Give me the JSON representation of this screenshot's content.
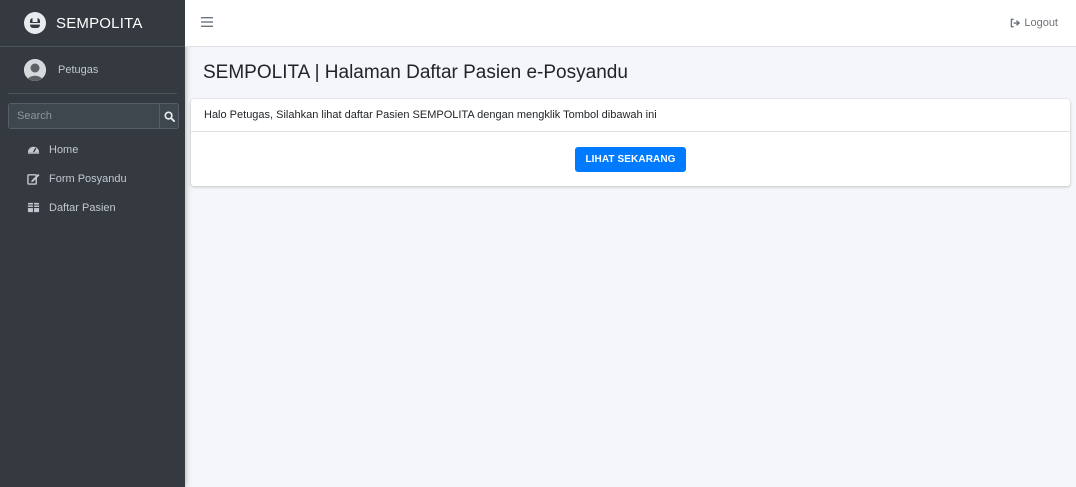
{
  "brand": {
    "name": "SEMPOLITA",
    "logo_icon": "brand-logo-icon"
  },
  "user": {
    "name": "Petugas",
    "avatar_icon": "user-avatar"
  },
  "search": {
    "placeholder": "Search",
    "icon": "search-icon"
  },
  "sidebar": {
    "items": [
      {
        "label": "Home",
        "icon": "dashboard-icon"
      },
      {
        "label": "Form Posyandu",
        "icon": "edit-icon"
      },
      {
        "label": "Daftar Pasien",
        "icon": "table-icon"
      }
    ]
  },
  "topbar": {
    "menu_icon": "hamburger-icon",
    "logout_label": "Logout",
    "logout_icon": "sign-out-icon"
  },
  "main": {
    "title": "SEMPOLITA | Halaman Daftar Pasien e-Posyandu",
    "card": {
      "header_text": "Halo Petugas, Silahkan lihat daftar Pasien SEMPOLITA dengan mengklik Tombol dibawah ini",
      "button_label": "LIHAT SEKARANG"
    }
  },
  "colors": {
    "sidebar_bg": "#343a40",
    "content_bg": "#f4f6f9",
    "primary": "#007bff"
  }
}
